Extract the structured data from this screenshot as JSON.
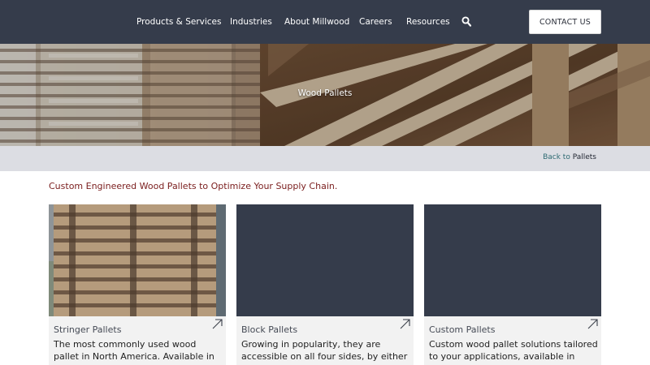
{
  "nav": {
    "items": [
      {
        "label": "Products & Services"
      },
      {
        "label": "Industries"
      },
      {
        "label": "About Millwood"
      },
      {
        "label": "Careers"
      },
      {
        "label": "Resources"
      }
    ],
    "search_icon": "search-icon",
    "contact_label": "CONTACT US"
  },
  "hero": {
    "title": "Wood Pallets"
  },
  "breadcrumb": {
    "prefix": "Back to ",
    "link": "Pallets"
  },
  "intro": {
    "text": "Custom Engineered Wood Pallets to Optimize Your Supply Chain."
  },
  "cards": [
    {
      "title": "Stringer Pallets",
      "description": "The most commonly used wood pallet in North America. Available in either two",
      "arrow_icon": "arrow-up-right-icon"
    },
    {
      "title": "Block Pallets",
      "description": "Growing in popularity, they are accessible on all four sides, by either",
      "arrow_icon": "arrow-up-right-icon"
    },
    {
      "title": "Custom Pallets",
      "description": "Custom wood pallet solutions tailored to your applications, available in either",
      "arrow_icon": "arrow-up-right-icon"
    }
  ],
  "colors": {
    "header_bg": "#353c4b",
    "breadcrumb_bg": "#dcdde3",
    "intro_text": "#7a1d1d",
    "card_bg": "#f2f2f2",
    "card_image_placeholder": "#353c4b"
  }
}
